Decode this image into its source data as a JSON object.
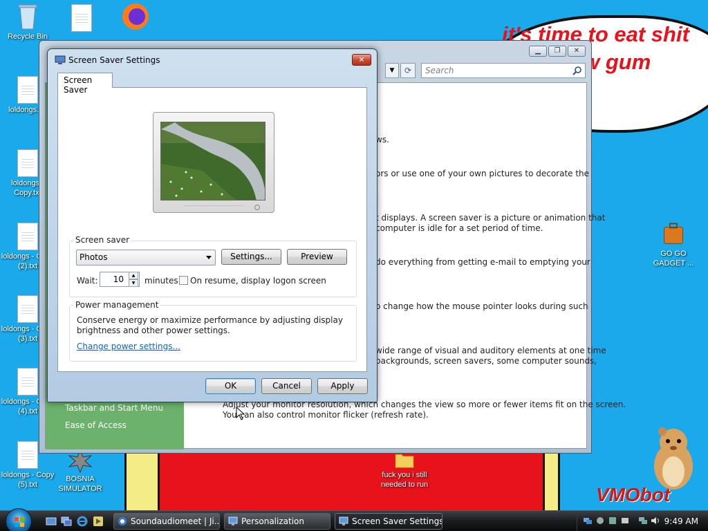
{
  "desktop": {
    "icons": [
      {
        "label": "Recycle Bin"
      },
      {
        "label": "loldongs.txt"
      },
      {
        "label": "loldongs - Copy.txt"
      },
      {
        "label": "loldongs - Copy (2).txt"
      },
      {
        "label": "loldongs - Copy (3).txt"
      },
      {
        "label": "loldongs - Copy (4).txt"
      },
      {
        "label": "loldongs - Copy (5).txt"
      },
      {
        "label": "BOSNIA SIMULATOR"
      },
      {
        "label": "GO GO GADGET ..."
      },
      {
        "label": "fuck you i still needed to run"
      }
    ],
    "wallpaper_text": {
      "bubble": "it's time to eat shit and chew gum",
      "logo": "VMObot"
    }
  },
  "personalization_window": {
    "search_placeholder": "Search",
    "sidebar_links": [
      "Taskbar and Start Menu",
      "Ease of Access"
    ],
    "text_lines": [
      "ws.",
      "ors or use one of your own pictures to decorate the",
      "t displays. A screen saver is a picture or animation that",
      "computer is idle for a set period of time.",
      "do everything from getting e-mail to emptying your",
      "o change how the mouse pointer looks during such",
      "wide range of visual and auditory elements at one time",
      "backgrounds, screen savers, some computer sounds,",
      "Adjust your monitor resolution, which changes the view so more or fewer items fit on the screen.",
      "You can also control monitor flicker (refresh rate)."
    ]
  },
  "dialog": {
    "title": "Screen Saver Settings",
    "close_label": "✕",
    "tab_label": "Screen Saver",
    "screen_saver_group": "Screen saver",
    "screen_saver_selected": "Photos",
    "settings_button": "Settings...",
    "preview_button": "Preview",
    "wait_label": "Wait:",
    "wait_value": "10",
    "minutes_label": "minutes",
    "resume_checkbox_label": "On resume, display logon screen",
    "resume_checked": false,
    "power_group": "Power management",
    "power_text_1": "Conserve energy or maximize performance by adjusting display",
    "power_text_2": "brightness and other power settings.",
    "power_link": "Change power settings...",
    "ok_button": "OK",
    "cancel_button": "Cancel",
    "apply_button": "Apply"
  },
  "taskbar": {
    "buttons": [
      {
        "label": "Soundaudiomeet | Ji..."
      },
      {
        "label": "Personalization"
      },
      {
        "label": "Screen Saver Settings"
      }
    ],
    "active_button": "Screen Saver Settings",
    "clock": "9:49 AM"
  },
  "colors": {
    "desktop_blue": "#1aa9ea",
    "wallpaper_red": "#e8121a",
    "wallpaper_yellow": "#f4ec86",
    "sidebar_green": "#6cb26c",
    "link_blue": "#0b66c7"
  }
}
